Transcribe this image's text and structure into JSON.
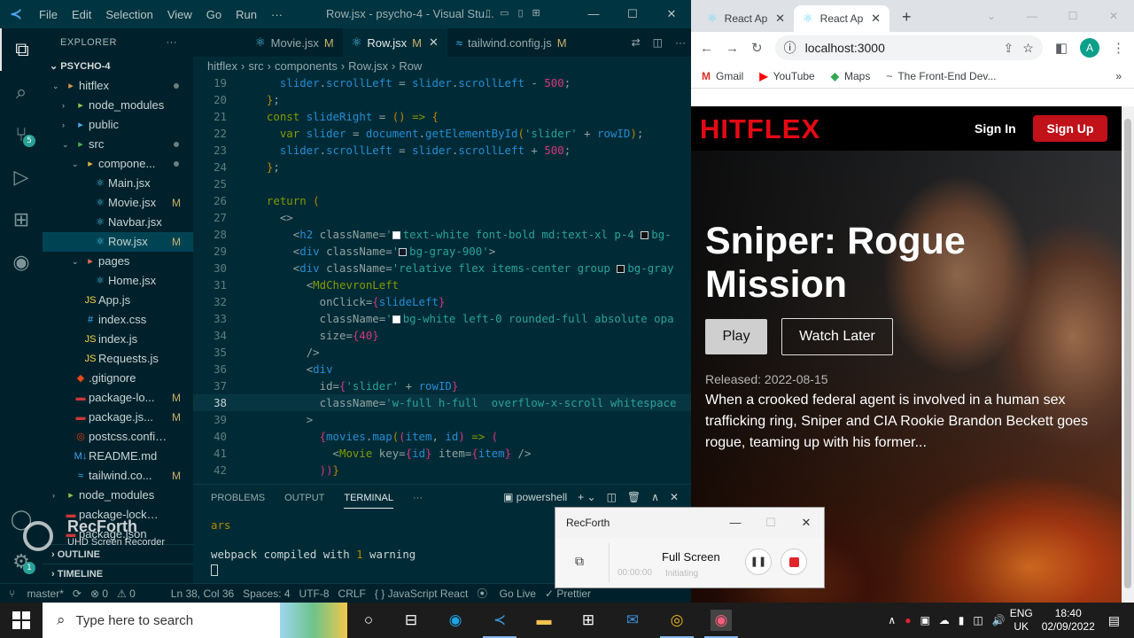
{
  "vscode": {
    "window_title": "Row.jsx - psycho-4 - Visual Stu...",
    "menu": [
      "File",
      "Edit",
      "Selection",
      "View",
      "Go",
      "Run",
      "···"
    ],
    "activity_badges": {
      "scm": "5",
      "settings": "1"
    },
    "explorer": {
      "header": "EXPLORER",
      "header_more": "···",
      "root": "PSYCHO-4",
      "items": [
        {
          "label": "hitflex",
          "indent": 1,
          "chevron": "down",
          "icon": "folder-icon",
          "dot": true
        },
        {
          "label": "node_modules",
          "indent": 2,
          "chevron": "right",
          "icon": "folder-node-icon"
        },
        {
          "label": "public",
          "indent": 2,
          "chevron": "right",
          "icon": "folder-public-icon"
        },
        {
          "label": "src",
          "indent": 2,
          "chevron": "down",
          "icon": "folder-src-icon",
          "dot": true
        },
        {
          "label": "compone...",
          "indent": 3,
          "chevron": "down",
          "icon": "folder-components-icon",
          "dot": true
        },
        {
          "label": "Main.jsx",
          "indent": 4,
          "icon": "react-icon"
        },
        {
          "label": "Movie.jsx",
          "indent": 4,
          "icon": "react-icon",
          "status": "M"
        },
        {
          "label": "Navbar.jsx",
          "indent": 4,
          "icon": "react-icon"
        },
        {
          "label": "Row.jsx",
          "indent": 4,
          "icon": "react-icon",
          "status": "M",
          "selected": true
        },
        {
          "label": "pages",
          "indent": 3,
          "chevron": "down",
          "icon": "folder-pages-icon"
        },
        {
          "label": "Home.jsx",
          "indent": 4,
          "icon": "react-icon"
        },
        {
          "label": "App.js",
          "indent": 3,
          "icon": "js-icon"
        },
        {
          "label": "index.css",
          "indent": 3,
          "icon": "css-icon"
        },
        {
          "label": "index.js",
          "indent": 3,
          "icon": "js-icon"
        },
        {
          "label": "Requests.js",
          "indent": 3,
          "icon": "js-icon"
        },
        {
          "label": ".gitignore",
          "indent": 2,
          "icon": "git-icon"
        },
        {
          "label": "package-lo...",
          "indent": 2,
          "icon": "npm-icon",
          "status": "M"
        },
        {
          "label": "package.js...",
          "indent": 2,
          "icon": "npm-icon",
          "status": "M"
        },
        {
          "label": "postcss.config.js",
          "indent": 2,
          "icon": "postcss-icon"
        },
        {
          "label": "README.md",
          "indent": 2,
          "icon": "markdown-icon"
        },
        {
          "label": "tailwind.co...",
          "indent": 2,
          "icon": "tailwind-icon",
          "status": "M"
        },
        {
          "label": "node_modules",
          "indent": 1,
          "chevron": "right",
          "icon": "folder-node-icon"
        },
        {
          "label": "package-lock.json",
          "indent": 1,
          "icon": "npm-icon"
        },
        {
          "label": "package.json",
          "indent": 1,
          "icon": "npm-icon"
        }
      ],
      "outline": "OUTLINE",
      "timeline": "TIMELINE"
    },
    "tabs": [
      {
        "label": "Movie.jsx",
        "status": "M",
        "active": false,
        "icon": "react-icon"
      },
      {
        "label": "Row.jsx",
        "status": "M",
        "active": true,
        "icon": "react-icon"
      },
      {
        "label": "tailwind.config.js",
        "status": "M",
        "active": false,
        "icon": "tailwind-icon"
      }
    ],
    "breadcrumb": [
      "hitflex",
      "src",
      "components",
      "Row.jsx",
      "Row"
    ],
    "code_lines": [
      {
        "n": "19",
        "html": "    <span class='v'>slider</span><span class='p'>.</span><span class='v'>scrollLeft</span> <span class='p'>=</span> <span class='v'>slider</span><span class='p'>.</span><span class='v'>scrollLeft</span> <span class='p'>-</span> <span class='n'>500</span><span class='p'>;</span>"
      },
      {
        "n": "20",
        "html": "  <span class='br'>}</span><span class='p'>;</span>"
      },
      {
        "n": "21",
        "html": "  <span class='kw'>const</span> <span class='v'>slideRight</span> <span class='p'>=</span> <span class='br'>()</span> <span class='kw'>=&gt;</span> <span class='br'>{</span>"
      },
      {
        "n": "22",
        "html": "    <span class='kw'>var</span> <span class='v'>slider</span> <span class='p'>=</span> <span class='v'>document</span><span class='p'>.</span><span class='v'>getElementById</span><span class='br'>(</span><span class='s'>'slider'</span> <span class='p'>+</span> <span class='v'>rowID</span><span class='br'>)</span><span class='p'>;</span>"
      },
      {
        "n": "23",
        "html": "    <span class='v'>slider</span><span class='p'>.</span><span class='v'>scrollLeft</span> <span class='p'>=</span> <span class='v'>slider</span><span class='p'>.</span><span class='v'>scrollLeft</span> <span class='p'>+</span> <span class='n'>500</span><span class='p'>;</span>"
      },
      {
        "n": "24",
        "html": "  <span class='br'>}</span><span class='p'>;</span>"
      },
      {
        "n": "25",
        "html": ""
      },
      {
        "n": "26",
        "html": "  <span class='kw'>return</span> <span class='br'>(</span>"
      },
      {
        "n": "27",
        "html": "    <span class='p'>&lt;&gt;</span>"
      },
      {
        "n": "28",
        "html": "      <span class='p'>&lt;</span><span class='t'>h2</span> <span class='a'>className</span><span class='p'>=</span><span class='s'>'<i class=\"sw\" style=\"background:#fff\"></i>text-white font-bold md:text-xl p-4 <i class=\"sw\" style=\"background:#111\"></i>bg-</span>"
      },
      {
        "n": "29",
        "html": "      <span class='p'>&lt;</span><span class='t'>div</span> <span class='a'>className</span><span class='p'>=</span><span class='s'>'<i class=\"sw\" style=\"background:#111827\"></i>bg-gray-900'</span><span class='p'>&gt;</span>"
      },
      {
        "n": "30",
        "html": "      <span class='p'>&lt;</span><span class='t'>div</span> <span class='a'>className</span><span class='p'>=</span><span class='s'>'relative flex items-center group <i class=\"sw\" style=\"background:#111\"></i>bg-gray</span>"
      },
      {
        "n": "31",
        "html": "        <span class='p'>&lt;</span><span class='kw'>MdChevronLeft</span>"
      },
      {
        "n": "32",
        "html": "          <span class='a'>onClick</span><span class='p'>=</span><span class='n'>{</span><span class='v'>slideLeft</span><span class='n'>}</span>"
      },
      {
        "n": "33",
        "html": "          <span class='a'>className</span><span class='p'>=</span><span class='s'>'<i class=\"sw\" style=\"background:#fff\"></i>bg-white left-0 rounded-full absolute opa</span>"
      },
      {
        "n": "34",
        "html": "          <span class='a'>size</span><span class='p'>=</span><span class='n'>{40}</span>"
      },
      {
        "n": "35",
        "html": "        <span class='p'>/&gt;</span>"
      },
      {
        "n": "36",
        "html": "        <span class='p'>&lt;</span><span class='t'>div</span>"
      },
      {
        "n": "37",
        "html": "          <span class='a'>id</span><span class='p'>=</span><span class='n'>{</span><span class='s'>'slider'</span> <span class='p'>+</span> <span class='v'>rowID</span><span class='n'>}</span>"
      },
      {
        "n": "38",
        "html": "          <span class='a'>className</span><span class='p'>=</span><span class='s'>'w-full h-full  overflow-x-scroll whitespace</span>",
        "current": true
      },
      {
        "n": "39",
        "html": "        <span class='p'>&gt;</span>"
      },
      {
        "n": "40",
        "html": "          <span class='n'>{</span><span class='v'>movies</span><span class='p'>.</span><span class='v'>map</span><span class='br'>(</span><span class='n'>(</span><span class='v'>item</span><span class='p'>,</span> <span class='v'>id</span><span class='n'>)</span> <span class='kw'>=&gt;</span> <span class='n'>(</span>"
      },
      {
        "n": "41",
        "html": "            <span class='p'>&lt;</span><span class='kw'>Movie</span> <span class='a'>key</span><span class='p'>=</span><span class='n'>{</span><span class='v'>id</span><span class='n'>}</span> <span class='a'>item</span><span class='p'>=</span><span class='n'>{</span><span class='v'>item</span><span class='n'>}</span> <span class='p'>/&gt;</span>"
      },
      {
        "n": "42",
        "html": "          <span class='n'>))</span><span class='br'>}</span>"
      }
    ],
    "panel": {
      "tabs": [
        "PROBLEMS",
        "OUTPUT",
        "TERMINAL"
      ],
      "active_tab": "TERMINAL",
      "more": "···",
      "shell": "powershell",
      "terminal_lines": [
        "ars",
        "",
        "webpack compiled with 1 warning"
      ],
      "warning_count": "1"
    },
    "status": {
      "branch": "master*",
      "errors": "⊗ 0",
      "warnings": "⚠ 0",
      "position": "Ln 38, Col 36",
      "spaces": "Spaces: 4",
      "encoding": "UTF-8",
      "eol": "CRLF",
      "language": "{ }  JavaScript React",
      "golive": "Go Live",
      "prettier": "✓ Prettier"
    }
  },
  "chrome": {
    "tabs": [
      {
        "label": "React Ap",
        "active": false
      },
      {
        "label": "React Ap",
        "active": true
      }
    ],
    "url": "localhost:3000",
    "profile_initial": "A",
    "bookmarks": [
      "Gmail",
      "YouTube",
      "Maps",
      "The Front-End Dev..."
    ],
    "bookmarks_more": "»"
  },
  "site": {
    "logo": "HITFLEX",
    "signin": "Sign In",
    "signup": "Sign Up",
    "movie_title": "Sniper: Rogue Mission",
    "play": "Play",
    "watch_later": "Watch Later",
    "released": "Released: 2022-08-15",
    "overview": "When a crooked federal agent is involved in a human sex trafficking ring, Sniper and CIA Rookie Brandon Beckett goes rogue, teaming up with his former..."
  },
  "recforth": {
    "title": "RecForth",
    "mode": "Full Screen",
    "time": "00:00:00",
    "status": "Initiating"
  },
  "watermark": {
    "name": "RecForth",
    "tagline": "UHD Screen Recorder"
  },
  "taskbar": {
    "search_placeholder": "Type here to search",
    "language": "ENG",
    "region": "UK",
    "time": "18:40",
    "date": "02/09/2022"
  }
}
